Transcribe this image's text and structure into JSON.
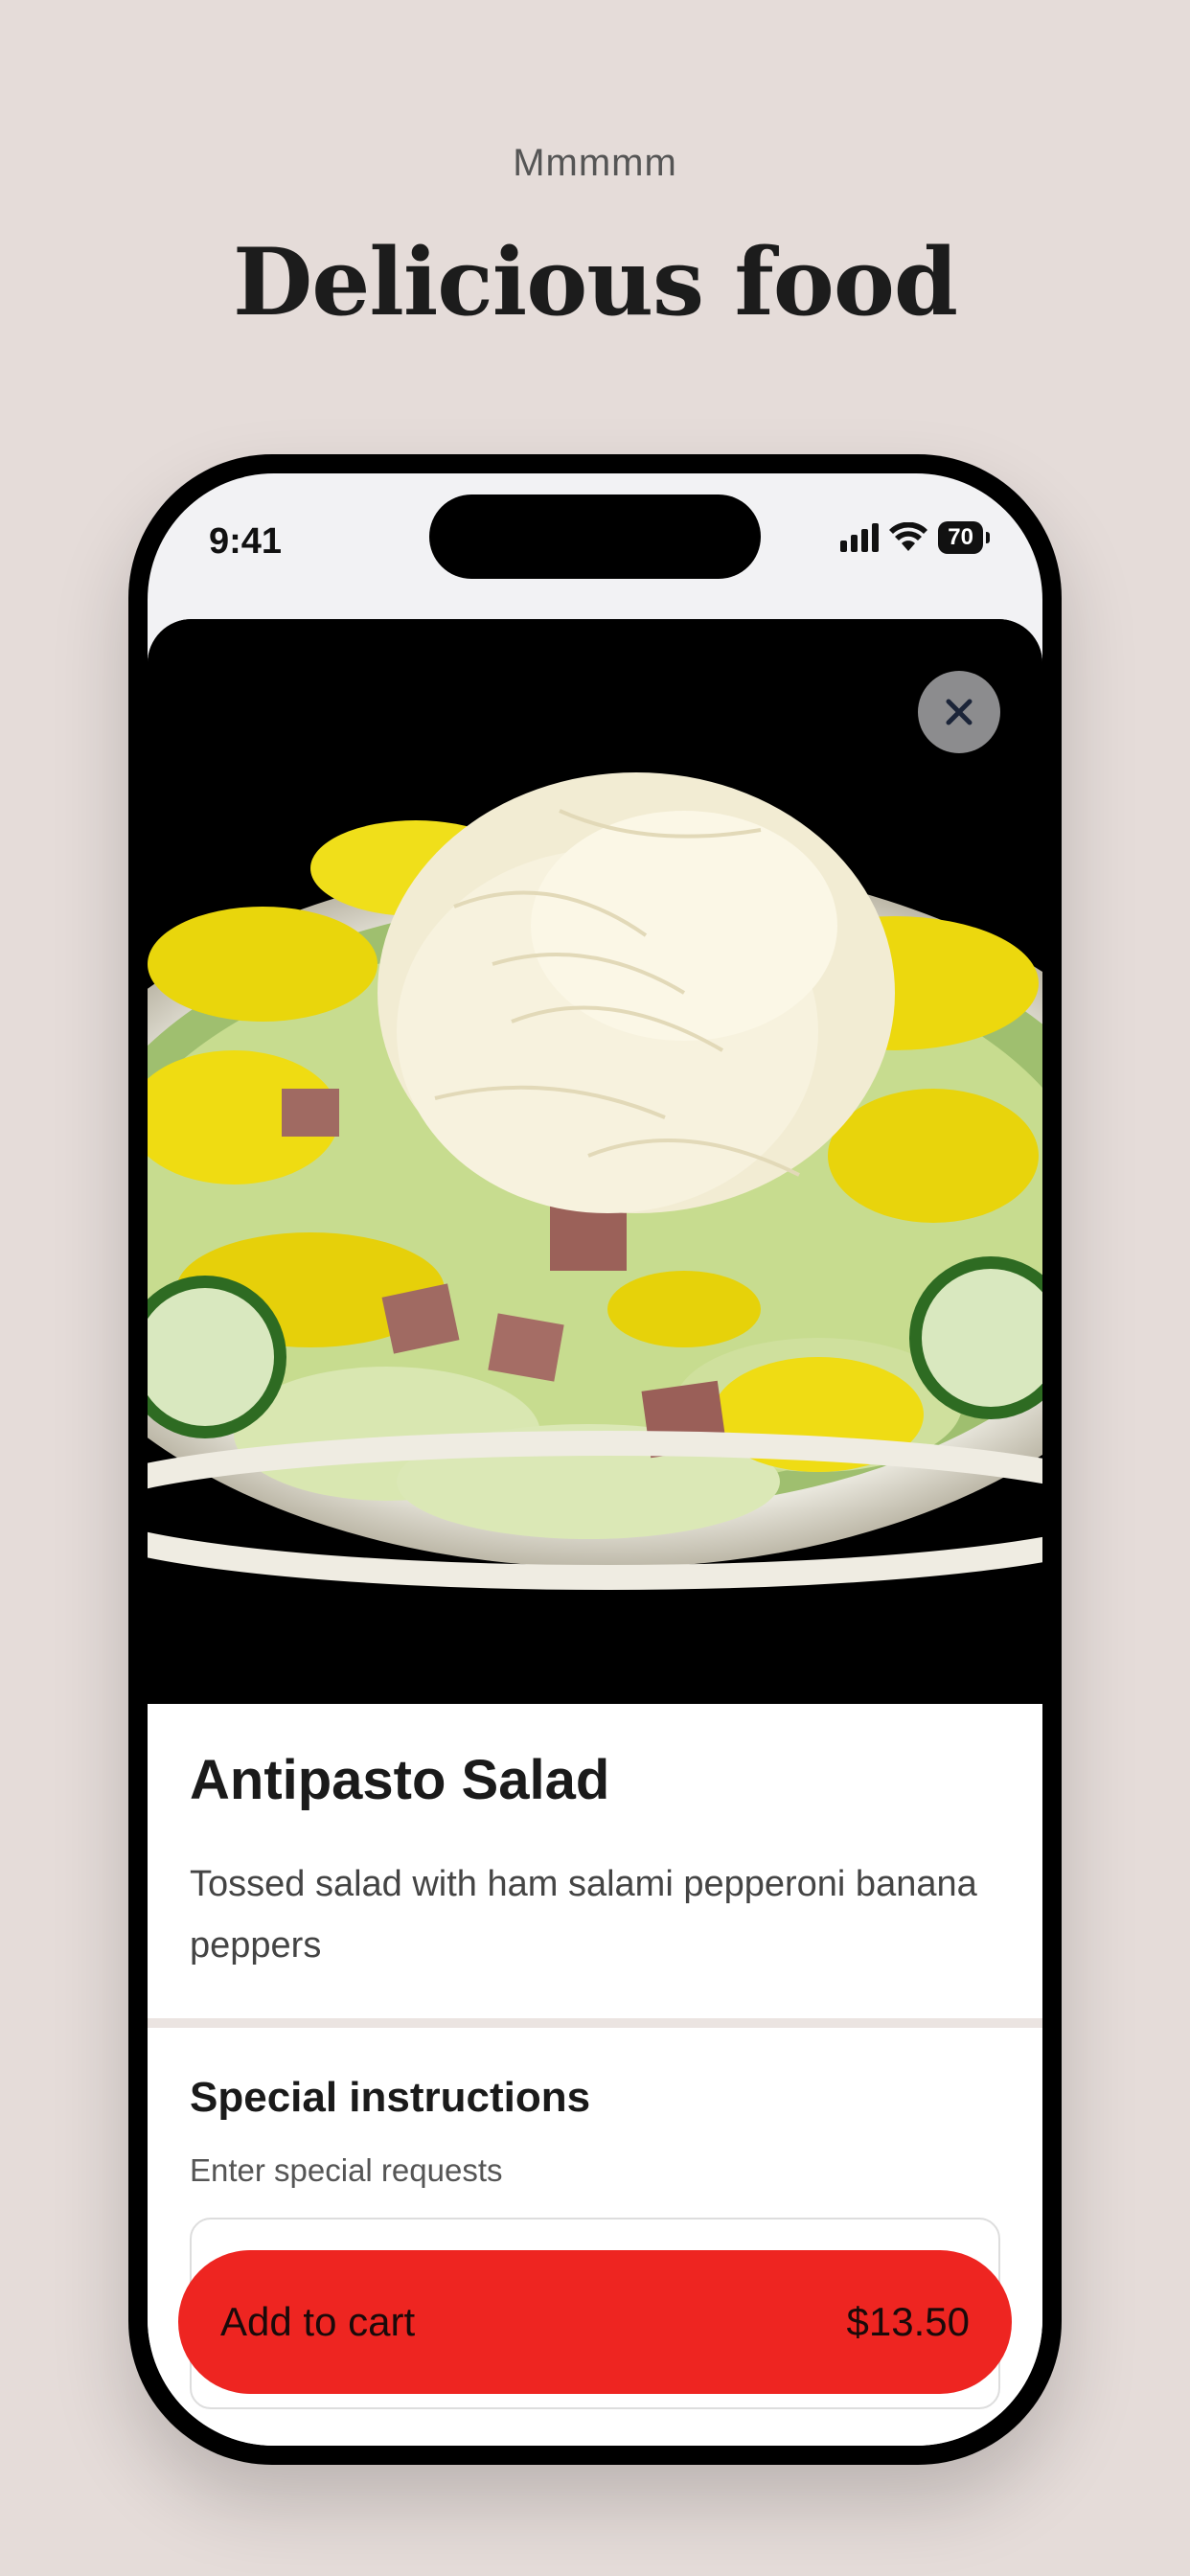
{
  "promo": {
    "eyebrow": "Mmmmm",
    "headline": "Delicious food"
  },
  "status_bar": {
    "time": "9:41",
    "battery": "70"
  },
  "item": {
    "name": "Antipasto Salad",
    "description": "Tossed salad with ham salami pepperoni banana peppers"
  },
  "special_instructions": {
    "title": "Special instructions",
    "hint": "Enter special requests",
    "value": ""
  },
  "cart": {
    "label": "Add to cart",
    "price": "$13.50"
  },
  "colors": {
    "background": "#e5dcd9",
    "accent": "#ee2521"
  },
  "icons": {
    "close": "close-icon",
    "signal": "cellular-signal-icon",
    "wifi": "wifi-icon",
    "battery": "battery-icon"
  }
}
